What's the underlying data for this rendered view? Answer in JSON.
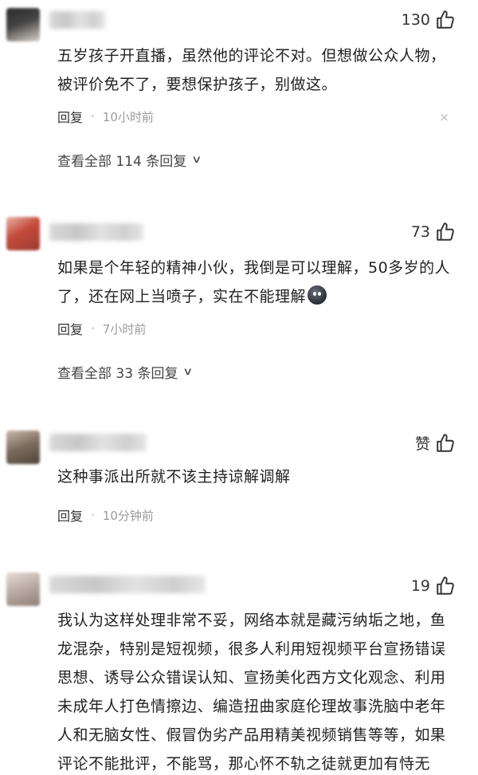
{
  "comments": [
    {
      "likes": "130",
      "text": "五岁孩子开直播，虽然他的评论不对。但想做公众人物，被评价免不了，要想保护孩子，别做这。",
      "reply_label": "回复",
      "time": "10小时前",
      "view_all": "查看全部 114 条回复",
      "avatar_colors": [
        "#2b2b2b",
        "#6b6b6b",
        "#d8d0c8"
      ]
    },
    {
      "likes": "73",
      "text_before_emoji": "如果是个年轻的精神小伙，我倒是可以理解，50多岁的人了，还在网上当喷子，实在不能理解",
      "reply_label": "回复",
      "time": "7小时前",
      "view_all": "查看全部 33 条回复",
      "avatar_colors": [
        "#c44a3a",
        "#e8b3a6",
        "#9a3b33"
      ]
    },
    {
      "likes": "赞",
      "text": "这种事派出所就不该主持谅解调解",
      "reply_label": "回复",
      "time": "10分钟前",
      "avatar_colors": [
        "#7a6a5c",
        "#c9b9a8",
        "#4f4539"
      ]
    },
    {
      "likes": "19",
      "text": "我认为这样处理非常不妥，网络本就是藏污纳垢之地，鱼龙混杂，特别是短视频，很多人利用短视频平台宣扬错误思想、诱导公众错误认知、宣扬美化西方文化观念、利用未成年人打色情擦边、编造扭曲家庭伦理故事洗脑中老年人和无脑女性、假冒伪劣产品用精美视频销售等等，如果评论不能批评，不能骂，那心怀不轨之徒就更加有恃无恐，小孩短视频如果全是",
      "avatar_colors": [
        "#b9aaa3",
        "#e6dcd6",
        "#8e7f78"
      ]
    }
  ],
  "close_symbol": "×"
}
